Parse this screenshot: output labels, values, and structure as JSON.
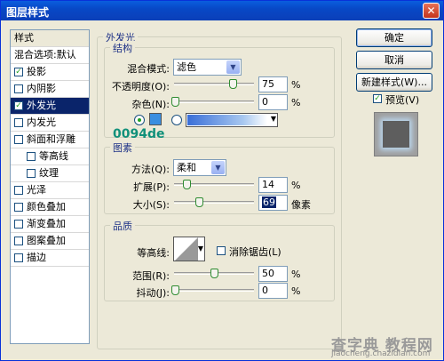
{
  "window": {
    "title": "图层样式",
    "close_glyph": "✕"
  },
  "sidebar": {
    "header": "样式",
    "blend_options": "混合选项:默认",
    "items": [
      {
        "label": "投影",
        "checked": true
      },
      {
        "label": "内阴影",
        "checked": false
      },
      {
        "label": "外发光",
        "checked": true,
        "selected": true
      },
      {
        "label": "内发光",
        "checked": false
      },
      {
        "label": "斜面和浮雕",
        "checked": false
      },
      {
        "label": "等高线",
        "checked": false
      },
      {
        "label": "纹理",
        "checked": false
      },
      {
        "label": "光泽",
        "checked": false
      },
      {
        "label": "颜色叠加",
        "checked": false
      },
      {
        "label": "渐变叠加",
        "checked": false
      },
      {
        "label": "图案叠加",
        "checked": false
      },
      {
        "label": "描边",
        "checked": false
      }
    ]
  },
  "panel": {
    "title": "外发光",
    "structure": {
      "title": "结构",
      "blend_mode_label": "混合模式:",
      "blend_mode_value": "滤色",
      "opacity_label": "不透明度(O):",
      "opacity_value": "75",
      "noise_label": "杂色(N):",
      "noise_value": "0",
      "unit": "%",
      "color_swatch": "#3a8ee0",
      "annotation": "0094de"
    },
    "elements": {
      "title": "图素",
      "method_label": "方法(Q):",
      "method_value": "柔和",
      "spread_label": "扩展(P):",
      "spread_value": "14",
      "size_label": "大小(S):",
      "size_value": "69",
      "percent": "%",
      "px_unit": "像素"
    },
    "quality": {
      "title": "品质",
      "contour_label": "等高线:",
      "antialias_label": "消除锯齿(L)",
      "range_label": "范围(R):",
      "range_value": "50",
      "jitter_label": "抖动(J):",
      "jitter_value": "0",
      "unit": "%"
    }
  },
  "buttons": {
    "ok": "确定",
    "cancel": "取消",
    "new_style": "新建样式(W)...",
    "preview_label": "预览(V)"
  },
  "watermark": {
    "brand": "查字典 教程网",
    "url": "jiaocheng.chazidian.com"
  }
}
